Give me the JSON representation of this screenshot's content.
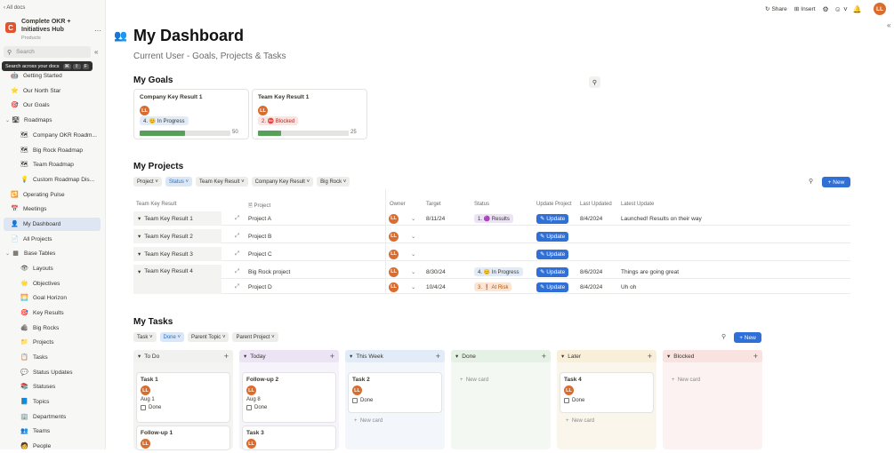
{
  "sidebar": {
    "back_label": "All docs",
    "doc_title": "Complete OKR + Initiatives Hub",
    "doc_subtitle": "Products",
    "search_placeholder": "Search",
    "search_tooltip": "Search across your docs",
    "items": [
      {
        "label": "Getting Started",
        "icon": "robot-icon"
      },
      {
        "label": "Our North Star",
        "icon": "star-icon"
      },
      {
        "label": "Our Goals",
        "icon": "target-icon"
      },
      {
        "label": "Roadmaps",
        "icon": "roadmap-icon"
      },
      {
        "label": "Company OKR Roadm...",
        "icon": "map-icon"
      },
      {
        "label": "Big Rock Roadmap",
        "icon": "map-icon"
      },
      {
        "label": "Team Roadmap",
        "icon": "map-icon"
      },
      {
        "label": "Custom Roadmap Dis...",
        "icon": "bulb-icon"
      },
      {
        "label": "Operating Pulse",
        "icon": "pulse-icon"
      },
      {
        "label": "Meetings",
        "icon": "calendar-icon"
      },
      {
        "label": "My Dashboard",
        "icon": "user-icon"
      },
      {
        "label": "All Projects",
        "icon": "doc-icon"
      },
      {
        "label": "Base Tables",
        "icon": "table-icon"
      },
      {
        "label": "Layouts",
        "icon": "layout-icon"
      },
      {
        "label": "Objectives",
        "icon": "star-icon"
      },
      {
        "label": "Goal Horizon",
        "icon": "horizon-icon"
      },
      {
        "label": "Key Results",
        "icon": "target-icon"
      },
      {
        "label": "Big Rocks",
        "icon": "rock-icon"
      },
      {
        "label": "Projects",
        "icon": "folder-icon"
      },
      {
        "label": "Tasks",
        "icon": "task-icon"
      },
      {
        "label": "Status Updates",
        "icon": "chat-icon"
      },
      {
        "label": "Statuses",
        "icon": "stack-icon"
      },
      {
        "label": "Topics",
        "icon": "topic-icon"
      },
      {
        "label": "Departments",
        "icon": "building-icon"
      },
      {
        "label": "Teams",
        "icon": "team-icon"
      },
      {
        "label": "People",
        "icon": "people-icon"
      }
    ]
  },
  "topbar": {
    "share_label": "Share",
    "insert_label": "Insert",
    "avatar_initials": "LL"
  },
  "page": {
    "title": "My Dashboard",
    "subtitle": "Current User - Goals, Projects & Tasks"
  },
  "goals": {
    "heading": "My Goals",
    "cards": [
      {
        "title": "Company Key Result 1",
        "avatar": "LL",
        "status": "4. 😊 In Progress",
        "progress_fraction": 0.5,
        "progress_value": "50"
      },
      {
        "title": "Team Key Result 1",
        "avatar": "LL",
        "status": "2. ⛔ Blocked",
        "progress_fraction": 0.25,
        "progress_value": "25"
      }
    ]
  },
  "projects": {
    "heading": "My Projects",
    "filters": [
      "Project",
      "Status",
      "Team Key Result",
      "Company Key Result",
      "Big Rock"
    ],
    "new_label": "New",
    "columns": [
      "Team Key Result",
      "Project",
      "Owner",
      "Target",
      "Status",
      "Update Project",
      "Last Updated",
      "Latest Update"
    ],
    "rows": [
      {
        "group": "Team Key Result 1",
        "project": "Project A",
        "owner": "LL",
        "target": "8/11/24",
        "status": "1. 🟣 Results",
        "update": "Update",
        "last_updated": "8/4/2024",
        "latest": "Launched! Results on their way"
      },
      {
        "group": "Team Key Result 2",
        "project": "Project B",
        "owner": "LL",
        "target": "",
        "status": "",
        "update": "Update",
        "last_updated": "",
        "latest": ""
      },
      {
        "group": "Team Key Result 3",
        "project": "Project C",
        "owner": "LL",
        "target": "",
        "status": "",
        "update": "Update",
        "last_updated": "",
        "latest": ""
      },
      {
        "group": "Team Key Result 4",
        "project": "Big Rock project",
        "owner": "LL",
        "target": "8/30/24",
        "status": "4. 😊 In Progress",
        "update": "Update",
        "last_updated": "8/6/2024",
        "latest": "Things are going great"
      },
      {
        "group": "",
        "project": "Project D",
        "owner": "LL",
        "target": "10/4/24",
        "status": "3. ❗ At Risk",
        "update": "Update",
        "last_updated": "8/4/2024",
        "latest": "Uh oh"
      }
    ]
  },
  "tasks": {
    "heading": "My Tasks",
    "filters": [
      "Task",
      "Done",
      "Parent Topic",
      "Parent Project"
    ],
    "new_label": "New",
    "new_card_label": "New card",
    "columns": [
      {
        "name": "To Do",
        "color": "#f1f1ef",
        "cards": [
          {
            "title": "Task 1",
            "date": "Aug 1",
            "done_label": "Done"
          },
          {
            "title": "Follow-up 1",
            "date": "",
            "done_label": ""
          }
        ]
      },
      {
        "name": "Today",
        "color": "#ece3f5",
        "cards": [
          {
            "title": "Follow-up 2",
            "date": "Aug 8",
            "done_label": "Done"
          },
          {
            "title": "Task 3",
            "date": "",
            "done_label": ""
          }
        ]
      },
      {
        "name": "This Week",
        "color": "#e2ecf8",
        "cards": [
          {
            "title": "Task 2",
            "date": "",
            "done_label": "Done"
          }
        ]
      },
      {
        "name": "Done",
        "color": "#e4f1e4",
        "cards": []
      },
      {
        "name": "Later",
        "color": "#f9efd9",
        "cards": [
          {
            "title": "Task 4",
            "date": "",
            "done_label": "Done"
          }
        ]
      },
      {
        "name": "Blocked",
        "color": "#f9e3e1",
        "cards": []
      }
    ]
  },
  "colors": {
    "accent": "#2f6fd6",
    "avatar": "#d96c2f",
    "progress": "#57a05a"
  }
}
